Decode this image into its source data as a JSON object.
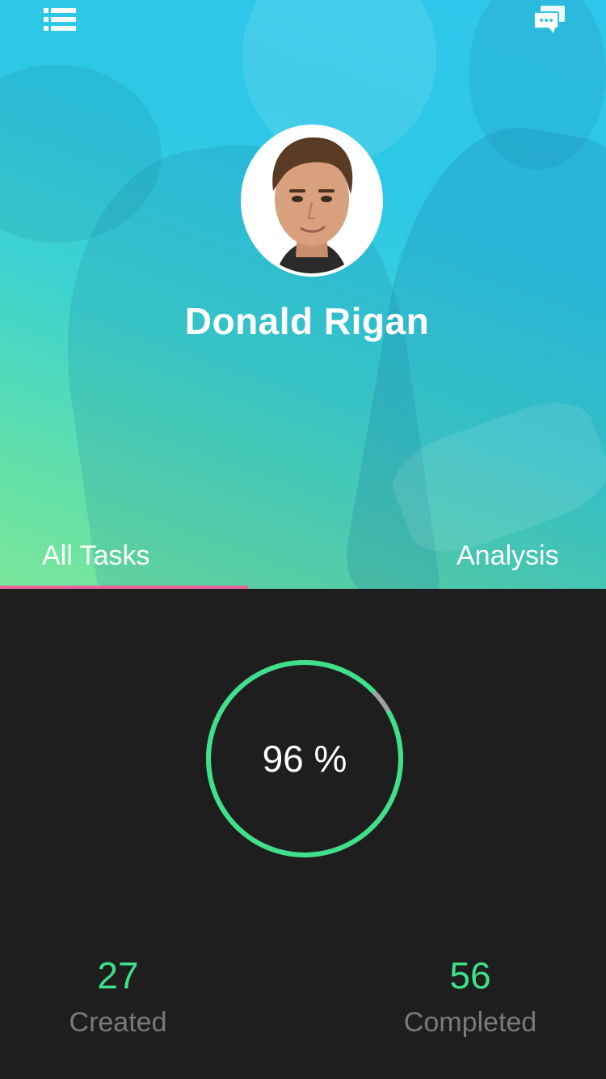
{
  "profile": {
    "name": "Donald Rigan"
  },
  "icons": {
    "menu": "list-menu-icon",
    "chat": "chat-bubbles-icon"
  },
  "tabs": [
    {
      "label": "All Tasks",
      "active": true
    },
    {
      "label": "Analysis",
      "active": false
    }
  ],
  "progress": {
    "value": 96,
    "label": "96 %"
  },
  "stats": {
    "created": {
      "value": "27",
      "label": "Created"
    },
    "completed": {
      "value": "56",
      "label": "Completed"
    }
  },
  "colors": {
    "accent_green": "#3ee08a",
    "tab_indicator": "#e8649b",
    "panel_bg": "#1e1e1e",
    "track_gray": "#a0a0a0"
  }
}
